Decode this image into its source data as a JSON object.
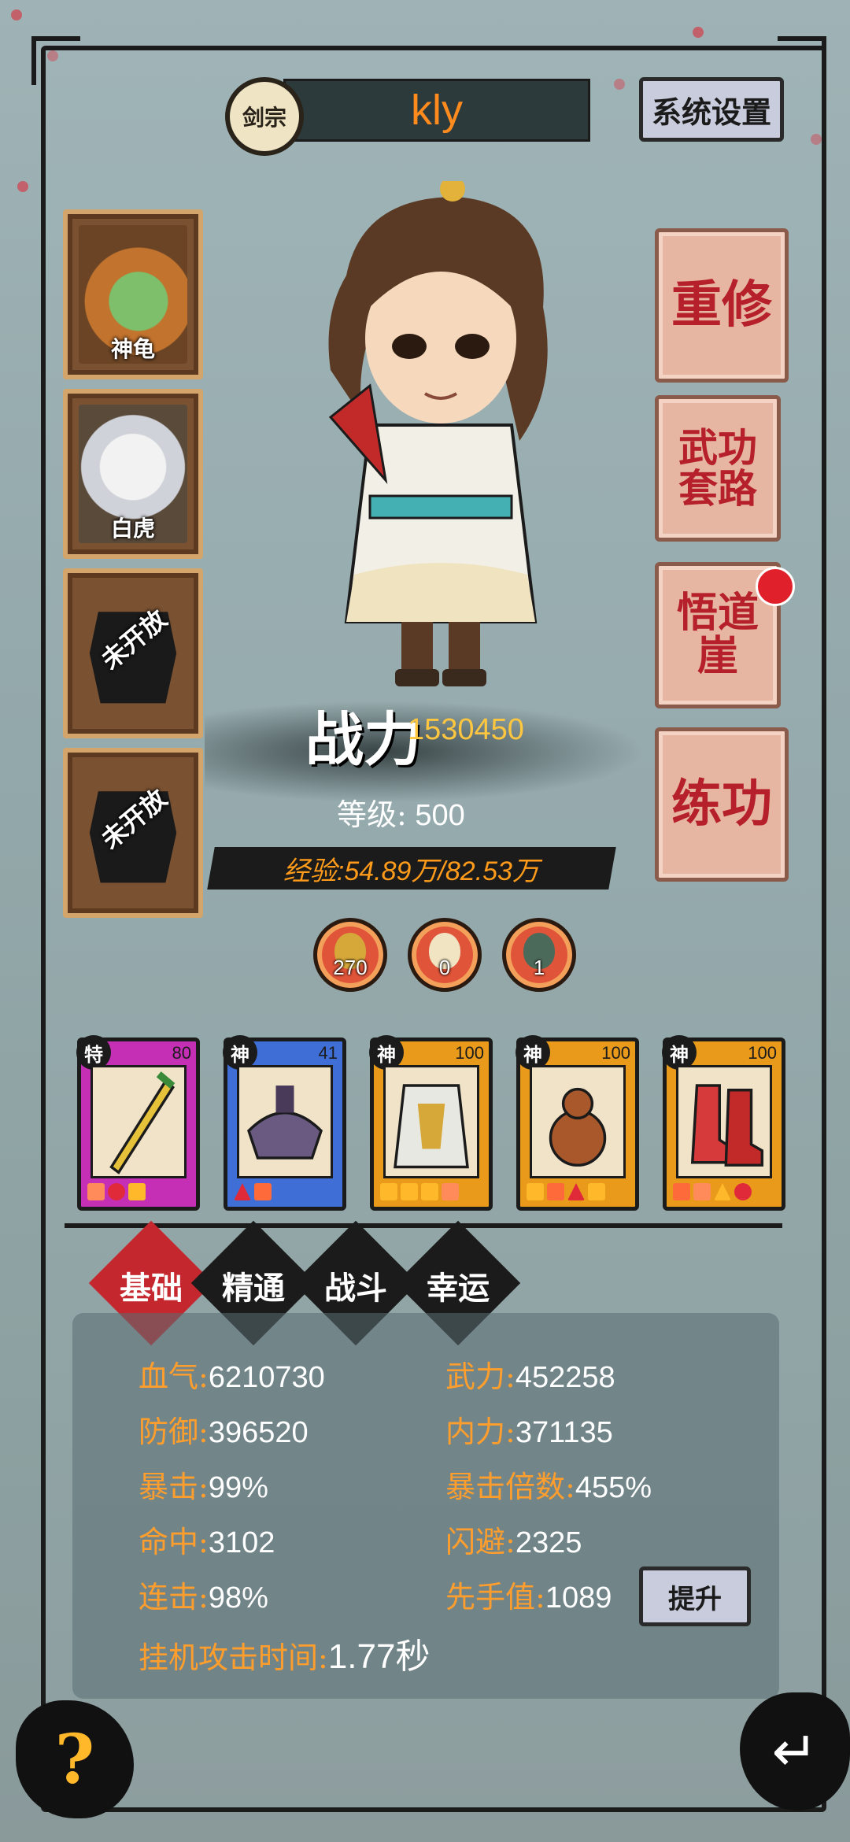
{
  "header": {
    "sect": "剑宗",
    "player_name": "kly",
    "settings_label": "系统设置"
  },
  "pets": [
    {
      "label": "神龟",
      "locked": false
    },
    {
      "label": "白虎",
      "locked": false
    },
    {
      "label": "未开放",
      "locked": true
    },
    {
      "label": "未开放",
      "locked": true
    }
  ],
  "side_buttons": [
    {
      "label": "重修"
    },
    {
      "label": "武功套路"
    },
    {
      "label": "悟道崖",
      "has_notification": true
    },
    {
      "label": "练功"
    }
  ],
  "power": {
    "label": "战力",
    "value": "1530450",
    "level_label": "等级:",
    "level_value": "500",
    "exp_text": "经验:54.89万/82.53万"
  },
  "consumables": [
    {
      "count": "270",
      "icon": "gold-egg-icon"
    },
    {
      "count": "0",
      "icon": "white-egg-icon"
    },
    {
      "count": "1",
      "icon": "green-egg-icon"
    }
  ],
  "equipment": [
    {
      "tier": "特",
      "level": "80",
      "icon": "sword-icon",
      "frame_color": "#c52fb5"
    },
    {
      "tier": "神",
      "level": "41",
      "icon": "hat-icon",
      "frame_color": "#3f6fd6"
    },
    {
      "tier": "神",
      "level": "100",
      "icon": "armor-icon",
      "frame_color": "#e99a1a"
    },
    {
      "tier": "神",
      "level": "100",
      "icon": "gourd-icon",
      "frame_color": "#e99a1a"
    },
    {
      "tier": "神",
      "level": "100",
      "icon": "boots-icon",
      "frame_color": "#e99a1a"
    }
  ],
  "tabs": [
    {
      "label": "基础",
      "active": true
    },
    {
      "label": "精通",
      "active": false
    },
    {
      "label": "战斗",
      "active": false
    },
    {
      "label": "幸运",
      "active": false
    }
  ],
  "stats": {
    "hp": {
      "k": "血气:",
      "v": "6210730"
    },
    "attack": {
      "k": "武力:",
      "v": "452258"
    },
    "defense": {
      "k": "防御:",
      "v": "396520"
    },
    "inner": {
      "k": "内力:",
      "v": "371135"
    },
    "crit": {
      "k": "暴击:",
      "v": "99%"
    },
    "crit_mult": {
      "k": "暴击倍数:",
      "v": "455%"
    },
    "hit": {
      "k": "命中:",
      "v": "3102"
    },
    "dodge": {
      "k": "闪避:",
      "v": "2325"
    },
    "combo": {
      "k": "连击:",
      "v": "98%"
    },
    "initiative": {
      "k": "先手值:",
      "v": "1089"
    },
    "idle": {
      "k": "挂机攻击时间:",
      "v": "1.77秒"
    }
  },
  "boost_label": "提升",
  "help_label": "?",
  "back_label": "↵"
}
